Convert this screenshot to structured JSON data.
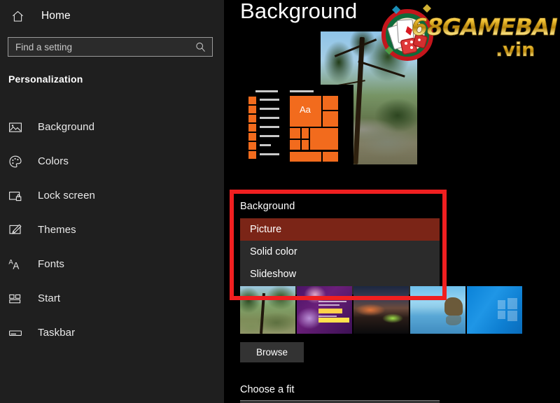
{
  "sidebar": {
    "home": {
      "label": "Home",
      "icon": "home-icon"
    },
    "search": {
      "placeholder": "Find a setting",
      "value": "",
      "icon": "search-icon"
    },
    "section_title": "Personalization",
    "items": [
      {
        "label": "Background",
        "icon": "image-icon"
      },
      {
        "label": "Colors",
        "icon": "palette-icon"
      },
      {
        "label": "Lock screen",
        "icon": "lock-screen-icon"
      },
      {
        "label": "Themes",
        "icon": "paintbrush-icon"
      },
      {
        "label": "Fonts",
        "icon": "font-aa-icon"
      },
      {
        "label": "Start",
        "icon": "start-tiles-icon"
      },
      {
        "label": "Taskbar",
        "icon": "taskbar-icon"
      }
    ]
  },
  "main": {
    "page_title": "Background",
    "preview": {
      "tile_letters": "Aa"
    },
    "background_group": {
      "label": "Background",
      "selected": "Picture",
      "options": [
        "Picture",
        "Solid color",
        "Slideshow"
      ]
    },
    "thumbnails": [
      {
        "name": "nature-tree-wallpaper"
      },
      {
        "name": "purple-poster-wallpaper"
      },
      {
        "name": "night-tent-wallpaper"
      },
      {
        "name": "blue-seascape-wallpaper"
      },
      {
        "name": "windows-logo-wallpaper"
      }
    ],
    "browse_button": "Browse",
    "choose_fit": {
      "label": "Choose a fit"
    }
  },
  "annotation": {
    "highlight_color": "#f01f20"
  },
  "watermark": {
    "text": "68GAMEBAI",
    "suffix": ".vin"
  },
  "colors": {
    "sidebar_bg": "#1f1f1f",
    "main_bg": "#000000",
    "accent_selected": "#7b2517",
    "tile_orange": "#f26b1d",
    "annotation_red": "#f01f20"
  }
}
